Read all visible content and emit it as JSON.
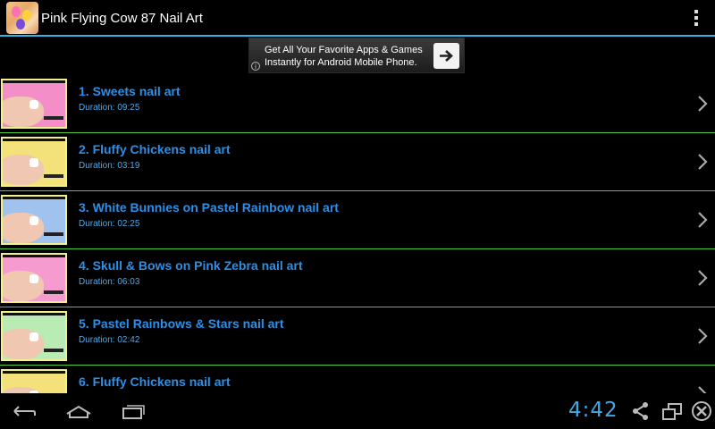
{
  "app": {
    "title": "Pink Flying Cow 87 Nail Art"
  },
  "ad": {
    "line1": "Get All Your Favorite Apps & Games",
    "line2": "Instantly for Android Mobile Phone.",
    "info_icon": "i"
  },
  "videos": [
    {
      "title": "1. Sweets nail art",
      "duration": "Duration: 09:25",
      "thumb_bg": "#f48ec8"
    },
    {
      "title": "2. Fluffy Chickens nail art",
      "duration": "Duration: 03:19",
      "thumb_bg": "#f3e27a"
    },
    {
      "title": "3. White Bunnies on Pastel Rainbow nail art",
      "duration": "Duration: 02:25",
      "thumb_bg": "#9fc3ee"
    },
    {
      "title": "4. Skull & Bows on Pink Zebra nail art",
      "duration": "Duration: 06:03",
      "thumb_bg": "#f59bd0"
    },
    {
      "title": "5. Pastel Rainbows & Stars nail art",
      "duration": "Duration: 02:42",
      "thumb_bg": "#b9ecb4"
    },
    {
      "title": "6. Fluffy Chickens nail art",
      "duration": "",
      "thumb_bg": "#f3e27a"
    }
  ],
  "status": {
    "time": "4:42"
  },
  "colors": {
    "accent": "#33b5e5",
    "divider": "#4ccb3e",
    "link": "#2e8fe6"
  }
}
